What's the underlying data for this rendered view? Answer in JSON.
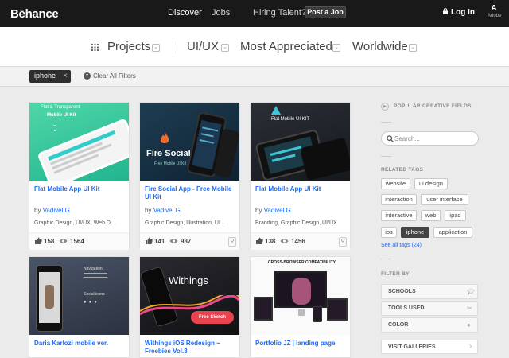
{
  "nav": {
    "logo": "Bēhance",
    "discover": "Discover",
    "jobs": "Jobs",
    "hiring": "Hiring Talent?",
    "post_job": "Post a Job",
    "login": "Log In",
    "adobe_mark": "A",
    "adobe_text": "Adobe"
  },
  "categories": {
    "projects": "Projects",
    "field": "UI/UX",
    "sort": "Most Appreciated",
    "location": "Worldwide",
    "chevron": "⌄"
  },
  "filters": {
    "chip": "iphone",
    "chip_x": "×",
    "clear_x": "×",
    "clear_all": "Clear All Filters"
  },
  "cards": [
    {
      "title": "Flat Mobile App UI Kit",
      "by_prefix": "by",
      "author": "Vadivel G",
      "tags": "Graphic Design, UI/UX, Web D...",
      "likes": "158",
      "views": "1564",
      "thumb_text1": "Flat & Transparent",
      "thumb_text2": "Mobile UI Kit"
    },
    {
      "title": "Fire Social App - Free Mobile UI Kit",
      "by_prefix": "by",
      "author": "Vadivel G",
      "tags": "Graphic Design, Illustration, UI...",
      "likes": "141",
      "views": "937",
      "thumb_text1": "Fire Social",
      "thumb_text2": "Free Mobile UI Kit"
    },
    {
      "title": "Flat Mobile App UI Kit",
      "by_prefix": "by",
      "author": "Vadivel G",
      "tags": "Branding, Graphic Design, UI/UX",
      "likes": "138",
      "views": "1456",
      "thumb_text1": "Flat Mobile UI KIT",
      "thumb_text2": ""
    },
    {
      "title": "Daria Karlozi mobile ver.",
      "thumb_text1": "Navigation",
      "thumb_text2": "Social icons"
    },
    {
      "title": "Withings iOS Redesign ~ Freebies Vol.3",
      "thumb_text1": "Withings",
      "thumb_text2": "Free Sketch"
    },
    {
      "title": "Portfolio JZ | landing page",
      "thumb_text1": "CROSS-BROWSER COMPATIBILITY",
      "thumb_text2": ""
    }
  ],
  "sidebar": {
    "popular": "POPULAR CREATIVE FIELDS",
    "search_placeholder": "Search...",
    "related_tags": "RELATED TAGS",
    "tags": [
      "website",
      "ui design",
      "interaction",
      "user interface",
      "interactive",
      "web",
      "ipad",
      "ios",
      "iphone",
      "application"
    ],
    "see_all": "See all tags (24)",
    "filter_by": "FILTER BY",
    "schools": "SCHOOLS",
    "tools_used": "TOOLS USED",
    "color": "COLOR",
    "visit_galleries": "VISIT GALLERIES"
  },
  "colors": {
    "link": "#1769ff",
    "nav_bg": "#191919"
  }
}
